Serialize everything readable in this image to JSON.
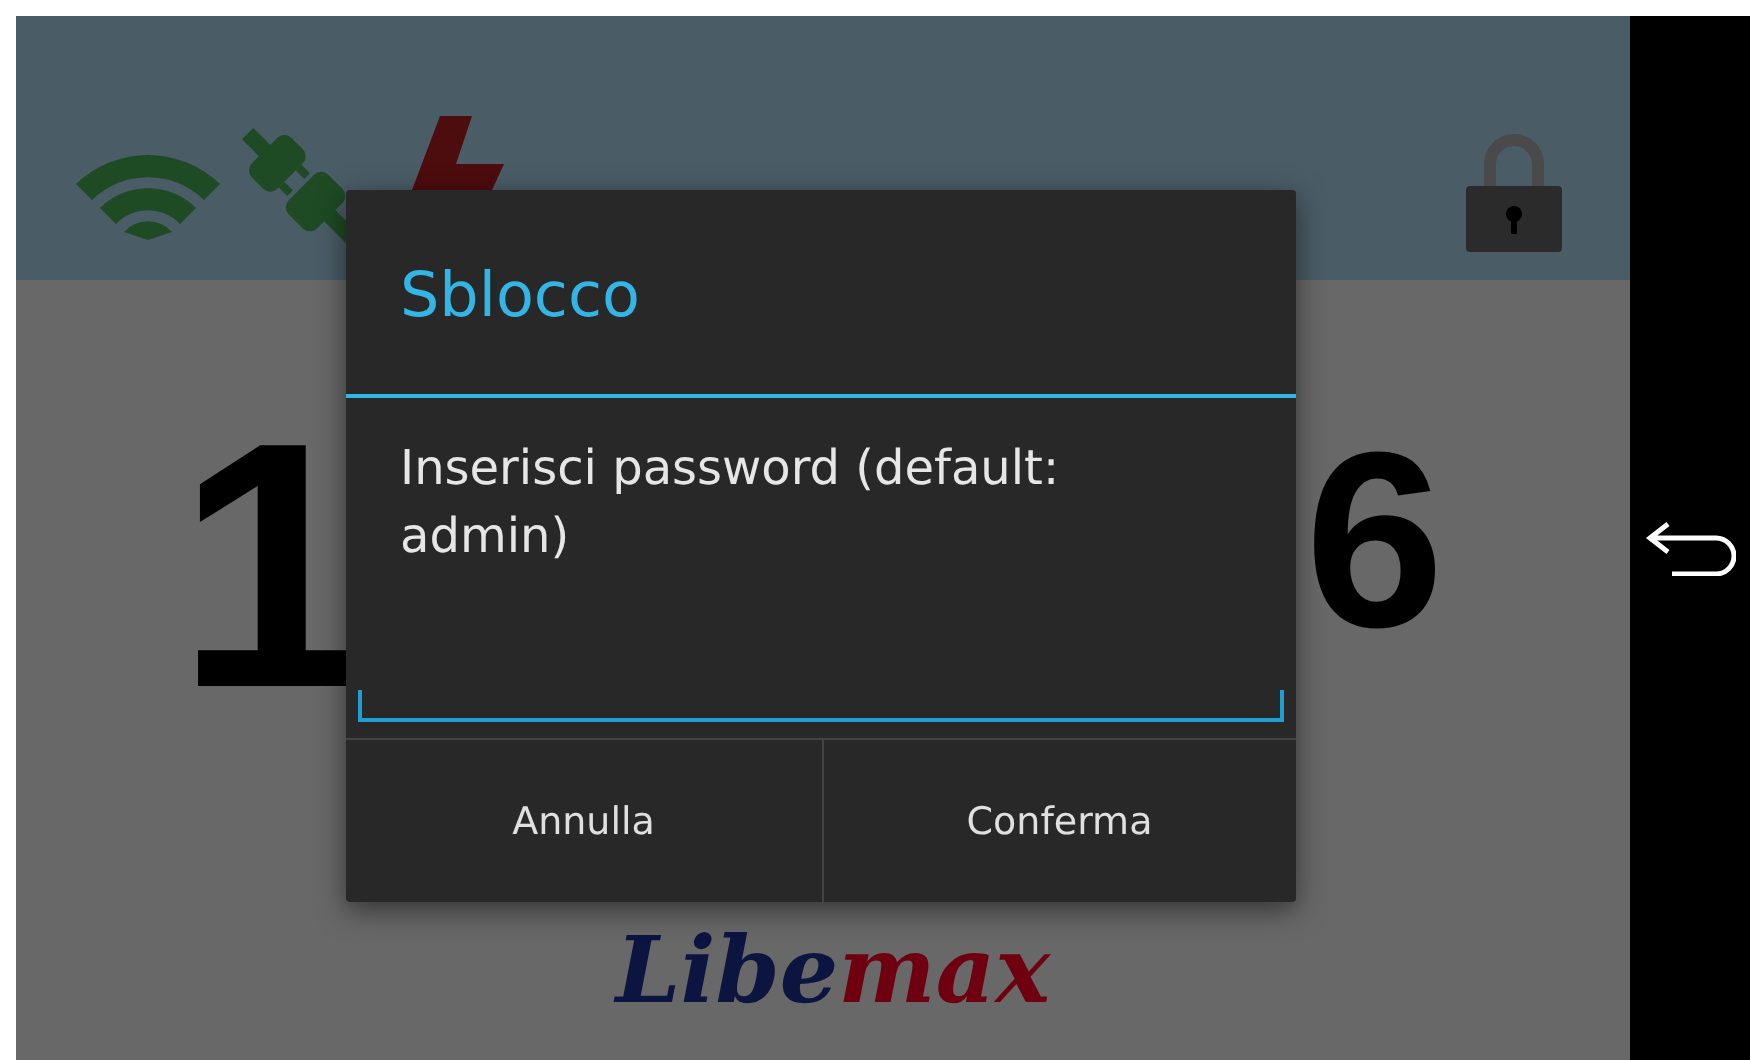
{
  "counter": {
    "digits": [
      "1",
      "6"
    ]
  },
  "logo": [
    "Libe",
    "max"
  ],
  "dialog": {
    "title": "Sblocco",
    "message": "Inserisci password (default: admin)",
    "buttons": [
      "Annulla",
      "Conferma"
    ]
  }
}
